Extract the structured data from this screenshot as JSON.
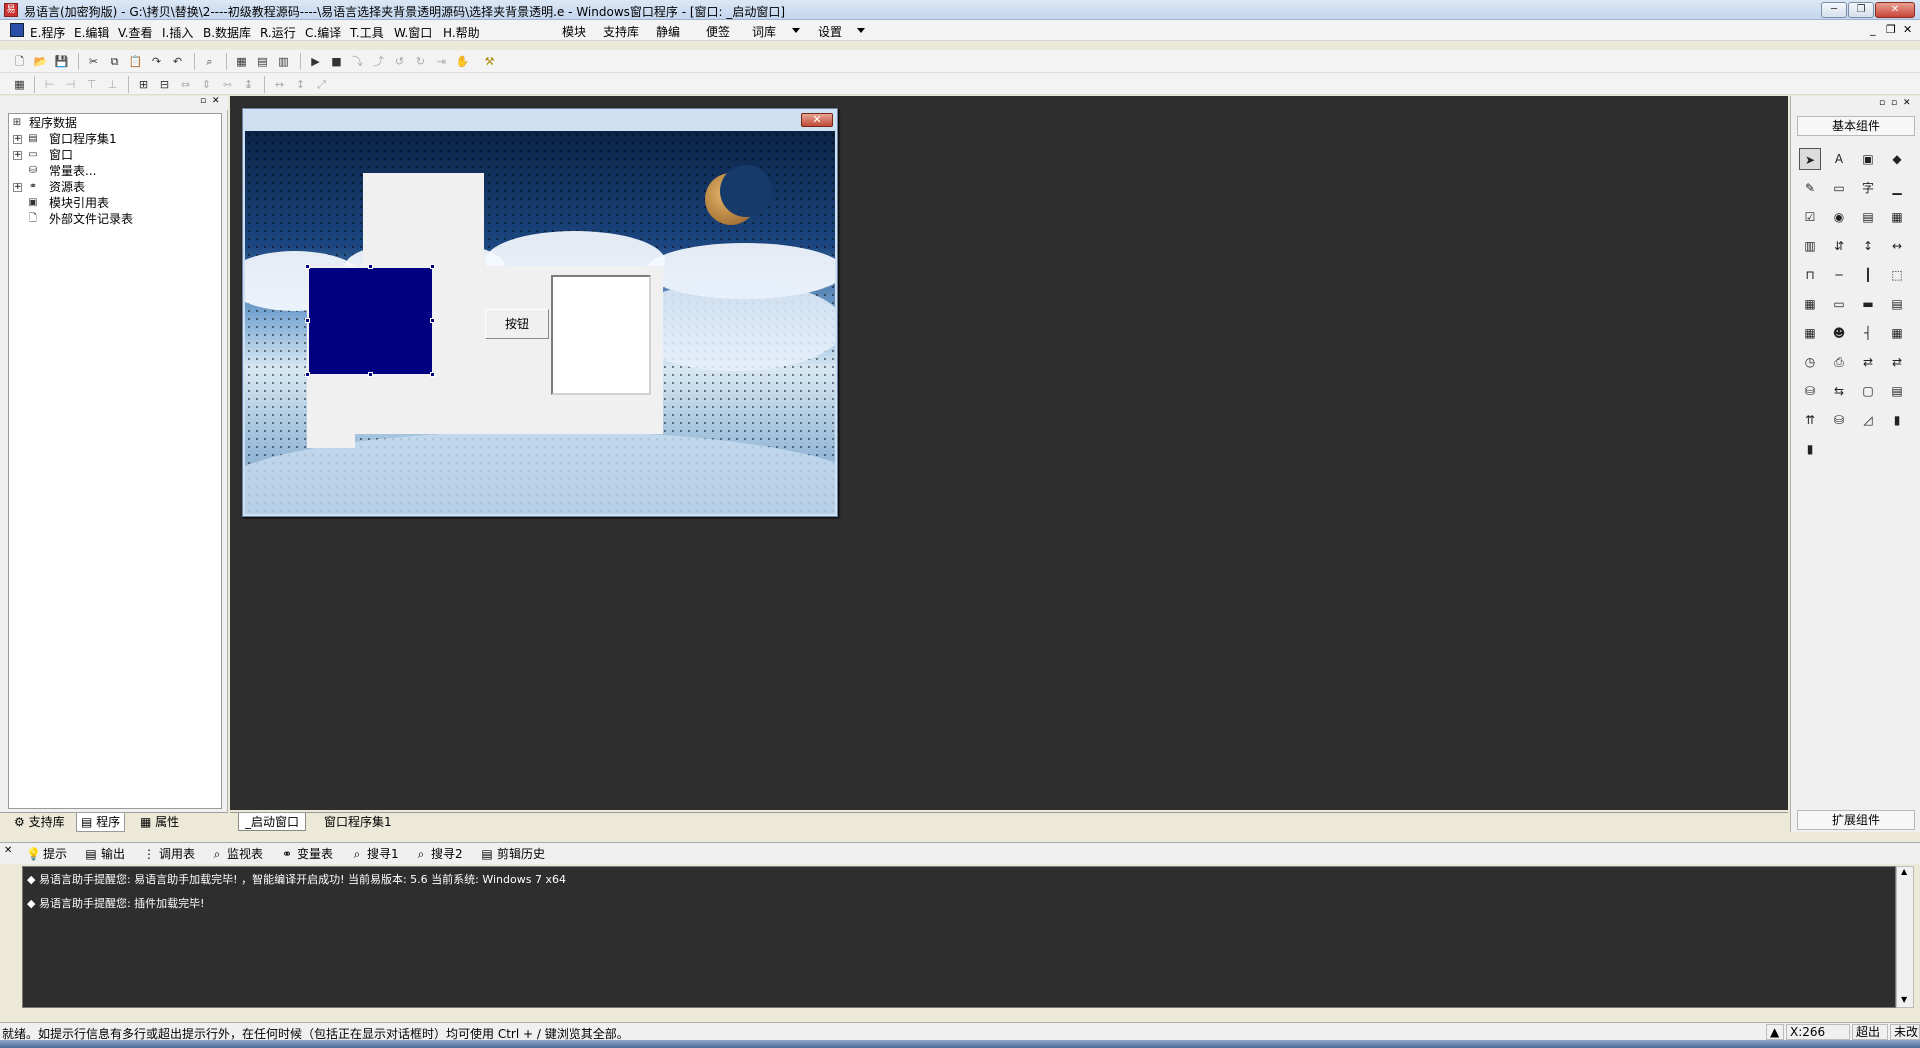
{
  "window": {
    "title": "易语言(加密狗版) - G:\\拷贝\\替换\\2----初级教程源码----\\易语言选择夹背景透明源码\\选择夹背景透明.e - Windows窗口程序 - [窗口: _启动窗口]",
    "app_icon": "易"
  },
  "caption_buttons": {
    "minimize": "─",
    "restore": "❐",
    "close": "✕"
  },
  "menu": {
    "items": [
      "E.程序",
      "E.编辑",
      "V.查看",
      "I.插入",
      "B.数据库",
      "R.运行",
      "C.编译",
      "T.工具",
      "W.窗口",
      "H.帮助"
    ],
    "extra": [
      "模块",
      "支持库",
      "静编",
      "便签",
      "词库",
      "设置"
    ]
  },
  "mdi_buttons": {
    "minimize": "_",
    "restore": "❐",
    "close": "✕"
  },
  "tree": {
    "root": "程序数据",
    "nodes": [
      "窗口程序集1",
      "窗口",
      "常量表...",
      "资源表",
      "模块引用表",
      "外部文件记录表"
    ]
  },
  "left_tabs": [
    "支持库",
    "程序",
    "属性"
  ],
  "form": {
    "button_label": "按钮",
    "close_glyph": "✕"
  },
  "doc_tabs": [
    "_启动窗口",
    "窗口程序集1"
  ],
  "palette": {
    "header": "基本组件",
    "footer": "扩展组件",
    "icons": [
      "arrow-pointer-icon",
      "label-icon",
      "picture-box-icon",
      "shape-icon",
      "edit-box-icon",
      "group-box-icon",
      "text-char-icon",
      "line-icon",
      "checkbox-icon",
      "radio-icon",
      "list-box-icon",
      "combo-list-icon",
      "grid-icon",
      "spinner-icon",
      "vertical-scroll-icon",
      "horizontal-scroll-icon",
      "tab-icon",
      "slider-icon",
      "vertical-slider-icon",
      "frame-icon",
      "calendar-icon",
      "date-picker-icon",
      "folder-icon",
      "page-icon",
      "table-icon",
      "user-icon",
      "split-icon",
      "toolbar-icon",
      "timer-icon",
      "printer-icon",
      "network-icon",
      "network2-icon",
      "db-icon",
      "pipe-icon",
      "window-icon",
      "list-view-icon",
      "data-source-icon",
      "data-provider-icon",
      "chart-icon",
      "odbc-icon",
      "odbc2-icon"
    ],
    "icon_glyphs": [
      "➤",
      "A",
      "▣",
      "◆",
      "✎",
      "▭",
      "字",
      "▁",
      "☑",
      "◉",
      "▤",
      "▦",
      "▥",
      "⇵",
      "↕",
      "↔",
      "⊓",
      "─",
      "┃",
      "⬚",
      "▦",
      "▭",
      "▬",
      "▤",
      "▦",
      "☻",
      "┤",
      "▦",
      "◷",
      "⎙",
      "⇄",
      "⇄",
      "⛁",
      "⇆",
      "▢",
      "▤",
      "⇈",
      "⛁",
      "◿",
      "▮",
      "▮"
    ]
  },
  "output_tabs": [
    "提示",
    "输出",
    "调用表",
    "监视表",
    "变量表",
    "搜寻1",
    "搜寻2",
    "剪辑历史"
  ],
  "output_lines": [
    "◆ 易语言助手提醒您: 易语言助手加载完毕! ，智能编译开启成功!  当前易版本: 5.6  当前系统: Windows 7 x64",
    "◆ 易语言助手提醒您: 插件加载完毕!"
  ],
  "status": {
    "text": "就绪。如提示行信息有多行或超出提示行外，在任何时候（包括正在显示对话框时）均可使用 Ctrl + / 键浏览其全部。",
    "coord": "X:266",
    "mode": "超出",
    "state": "未改"
  }
}
